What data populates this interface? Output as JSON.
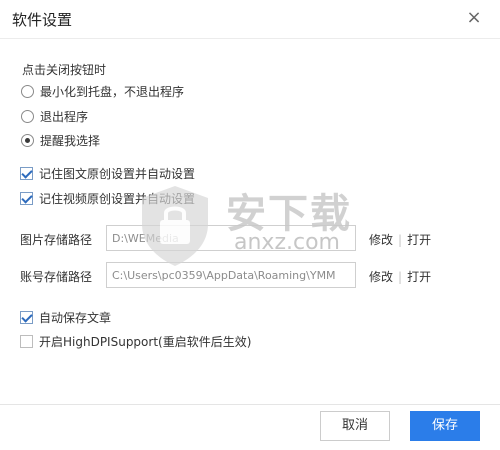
{
  "window": {
    "title": "软件设置",
    "close_glyph": "×"
  },
  "close_behavior": {
    "label": "点击关闭按钮时",
    "options": [
      {
        "label": "最小化到托盘，不退出程序",
        "selected": false
      },
      {
        "label": "退出程序",
        "selected": false
      },
      {
        "label": "提醒我选择",
        "selected": true
      }
    ]
  },
  "remember": {
    "article": {
      "label": "记住图文原创设置并自动设置",
      "checked": true
    },
    "video": {
      "label": "记住视频原创设置并自动设置",
      "checked": true
    }
  },
  "paths": {
    "image": {
      "label": "图片存储路径",
      "value": "D:\\WEMedia",
      "edit": "修改",
      "open": "打开"
    },
    "account": {
      "label": "账号存储路径",
      "value": "C:\\Users\\pc0359\\AppData\\Roaming\\YMM",
      "edit": "修改",
      "open": "打开"
    }
  },
  "options": {
    "autosave": {
      "label": "自动保存文章",
      "checked": true
    },
    "highdpi": {
      "label": "开启HighDPISupport(重启软件后生效)",
      "checked": false
    }
  },
  "buttons": {
    "cancel": "取消",
    "save": "保存"
  },
  "watermark": {
    "text": "安下载",
    "sub": "anxz.com"
  },
  "colors": {
    "accent": "#2b7de9"
  }
}
